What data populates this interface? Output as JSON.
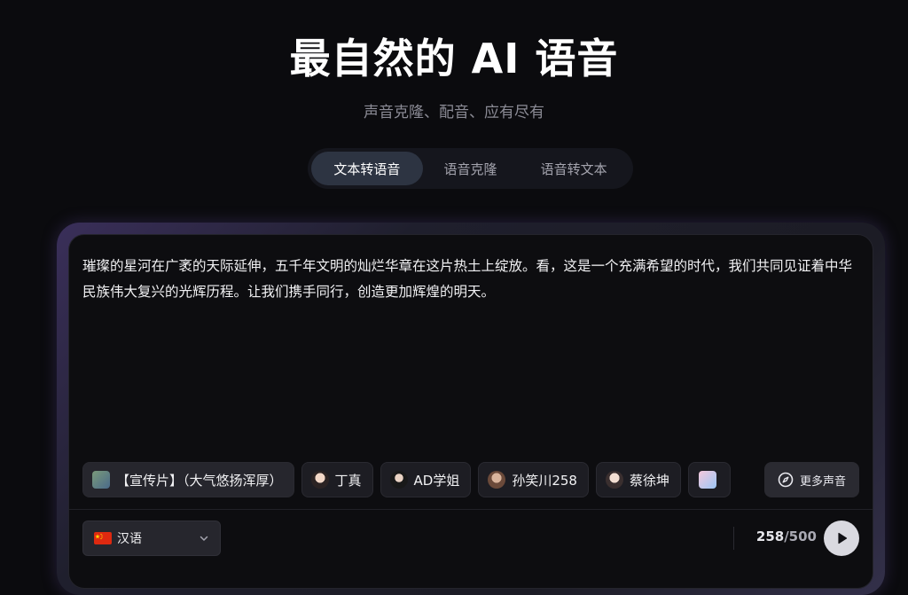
{
  "hero": {
    "title": "最自然的 AI 语音",
    "subtitle": "声音克隆、配音、应有尽有"
  },
  "tabs": [
    {
      "label": "文本转语音",
      "active": true
    },
    {
      "label": "语音克隆",
      "active": false
    },
    {
      "label": "语音转文本",
      "active": false
    }
  ],
  "editor": {
    "text": "璀璨的星河在广袤的天际延伸，五千年文明的灿烂华章在这片热土上绽放。看，这是一个充满希望的时代，我们共同见证着中华民族伟大复兴的光辉历程。让我们携手同行，创造更加辉煌的明天。"
  },
  "voices": [
    {
      "label": "【宣传片】（大气悠扬浑厚）",
      "icon": "landscape-avatar"
    },
    {
      "label": "丁真",
      "icon": "person-avatar"
    },
    {
      "label": "AD学姐",
      "icon": "person-avatar"
    },
    {
      "label": "孙笑川258",
      "icon": "person-avatar"
    },
    {
      "label": "蔡徐坤",
      "icon": "person-avatar"
    },
    {
      "label": "",
      "icon": "anime-avatar"
    }
  ],
  "more_voices": {
    "label": "更多声音",
    "icon": "compass-icon"
  },
  "language": {
    "label": "汉语",
    "icon": "china-flag-icon"
  },
  "counter": {
    "current": "258",
    "max": "/500"
  },
  "colors": {
    "background": "#0b0b0e",
    "tab_active": "#2d3442",
    "card_border_glow": "#3a2f5a",
    "play_button": "#d9d9e0"
  }
}
